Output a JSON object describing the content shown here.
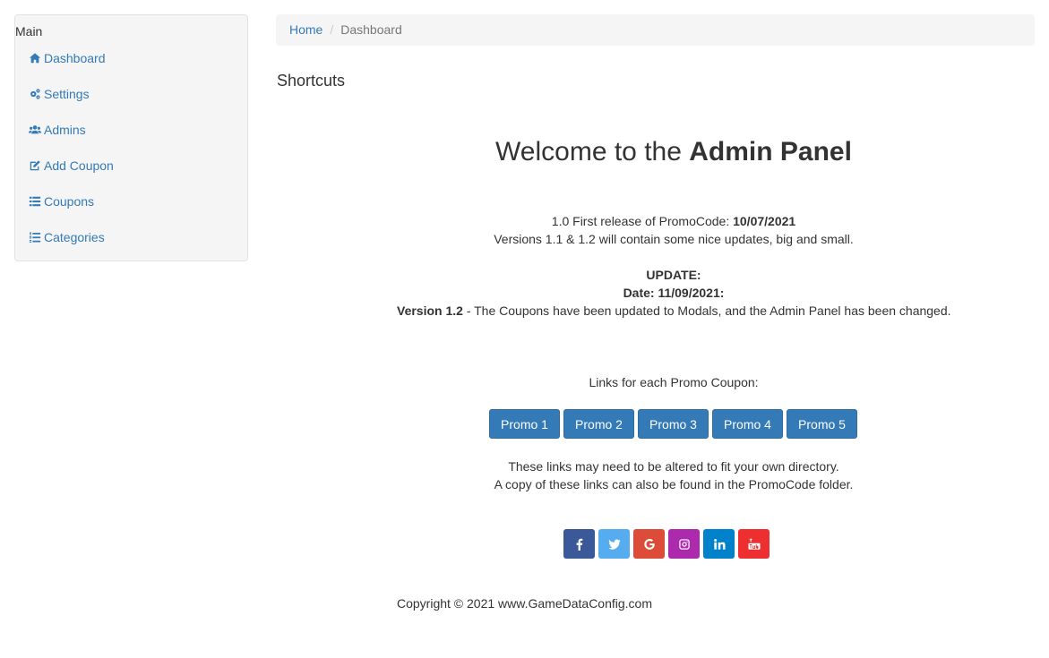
{
  "sidebar": {
    "heading": "Main",
    "items": [
      {
        "label": "Dashboard",
        "icon": "home-icon"
      },
      {
        "label": "Settings",
        "icon": "gears-icon"
      },
      {
        "label": "Admins",
        "icon": "users-icon"
      },
      {
        "label": "Add Coupon",
        "icon": "edit-icon"
      },
      {
        "label": "Coupons",
        "icon": "list-icon"
      },
      {
        "label": "Categories",
        "icon": "list-ol-icon"
      }
    ]
  },
  "breadcrumb": {
    "home": "Home",
    "separator": "/",
    "current": "Dashboard"
  },
  "main": {
    "section_title": "Shortcuts",
    "welcome_prefix": "Welcome to the ",
    "welcome_bold": "Admin Panel",
    "release_prefix": "1.0 First release of PromoCode: ",
    "release_date": "10/07/2021",
    "versions_note": "Versions 1.1 & 1.2 will contain some nice updates, big and small.",
    "update_heading": "UPDATE:",
    "update_date": "Date: 11/09/2021:",
    "version_label": "Version 1.2",
    "version_text": " - The Coupons have been updated to Modals, and the Admin Panel has been changed.",
    "links_heading": "Links for each Promo Coupon:",
    "promo_buttons": [
      "Promo 1",
      "Promo 2",
      "Promo 3",
      "Promo 4",
      "Promo 5"
    ],
    "links_note_1": "These links may need to be altered to fit your own directory.",
    "links_note_2": "A copy of these links can also be found in the PromoCode folder."
  },
  "social": [
    {
      "name": "facebook-icon",
      "color": "#3b5998"
    },
    {
      "name": "twitter-icon",
      "color": "#55acee"
    },
    {
      "name": "google-icon",
      "color": "#dd4b39"
    },
    {
      "name": "instagram-icon",
      "color": "#ac2bac"
    },
    {
      "name": "linkedin-icon",
      "color": "#0082ca"
    },
    {
      "name": "youtube-icon",
      "color": "#ed302f"
    }
  ],
  "footer": {
    "copyright": "Copyright © 2021 www.GameDataConfig.com"
  },
  "colors": {
    "primary": "#337ab7",
    "panel_bg": "#f5f5f5"
  }
}
